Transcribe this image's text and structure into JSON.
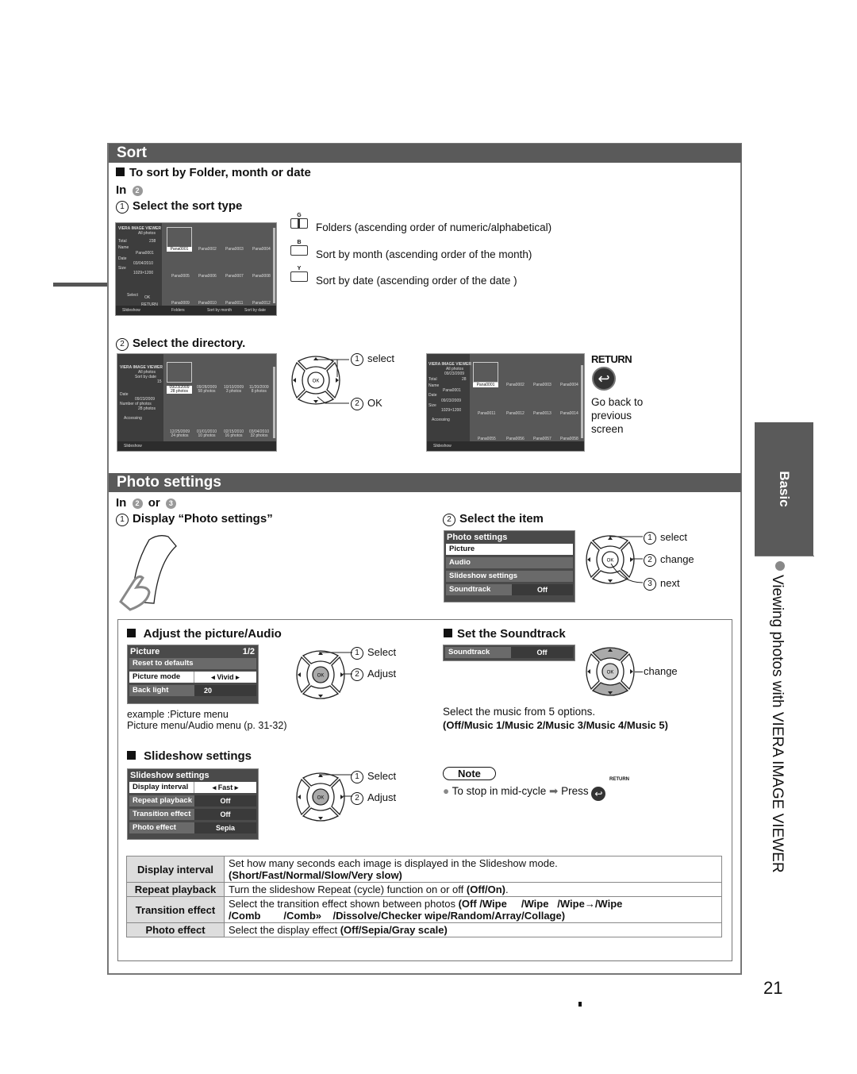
{
  "page_number": "21",
  "side_tab": {
    "label": "Basic"
  },
  "side_title": "Viewing photos with VIERA IMAGE VIEWER",
  "sort": {
    "header": "Sort",
    "subheading": "To sort by Folder, month or date",
    "in_step": "In",
    "in_step_num": "2",
    "step1": {
      "num": "1",
      "label": "Select the sort type"
    },
    "screen1": {
      "title": "VIERA IMAGE VIEWER",
      "subtitle": "All photos",
      "total_label": "Total",
      "total_value": "238",
      "name_label": "Name",
      "name_value": "Pana0001",
      "date_label": "Date",
      "date_value": "03/04/2010",
      "size_label": "Size",
      "size_value": "1029×1200",
      "thumbs": [
        "Pana0001",
        "Pana0002",
        "Pana0003",
        "Pana0004",
        "Pana0005",
        "Pana0006",
        "Pana0007",
        "Pana0008",
        "Pana0009",
        "Pana0010",
        "Pana0011",
        "Pana0012"
      ],
      "footer": [
        "Slideshow",
        "Folders",
        "Sort by month",
        "Sort by date"
      ],
      "select": "Select",
      "ok": "OK",
      "return": "RETURN"
    },
    "sort_options": [
      {
        "key": "G",
        "text": "Folders (ascending order of numeric/alphabetical)"
      },
      {
        "key": "B",
        "text": "Sort by month (ascending order of the month)"
      },
      {
        "key": "Y",
        "text": "Sort by date (ascending order of the date )"
      }
    ],
    "step2": {
      "num": "2",
      "label": "Select the directory."
    },
    "screen2": {
      "title": "VIERA IMAGE VIEWER",
      "subtitle": "All photos",
      "sort_label": "Sort by date",
      "count": "15",
      "date_label": "Date",
      "date_value": "09/23/2009",
      "num_label": "Number of photos",
      "num_value": "28 photos",
      "accessing": "Accessing",
      "thumbs": [
        {
          "date": "09/23/2009",
          "count": "28 photos"
        },
        {
          "date": "09/28/2009",
          "count": "58 photos"
        },
        {
          "date": "10/10/2009",
          "count": "3 photos"
        },
        {
          "date": "11/20/2009",
          "count": "8 photos"
        },
        {
          "date": "12/25/2009",
          "count": "24 photos"
        },
        {
          "date": "01/01/2010",
          "count": "10 photos"
        },
        {
          "date": "02/15/2010",
          "count": "16 photos"
        },
        {
          "date": "03/04/2010",
          "count": "32 photos"
        }
      ],
      "footer": [
        "Slideshow"
      ]
    },
    "dpad1": {
      "select": "select",
      "ok": "OK",
      "n1": "1",
      "n2": "2"
    },
    "screen3": {
      "title": "VIERA IMAGE VIEWER",
      "subtitle": "All photos",
      "date_hdr": "09/23/2009",
      "total_label": "Total",
      "total_value": "28",
      "name_label": "Name",
      "name_value": "Pana0001",
      "date_label": "Date",
      "date_value": "09/23/2009",
      "size_label": "Size",
      "size_value": "1029×1200",
      "accessing": "Accessing",
      "thumbs": [
        "Pana0001",
        "Pana0002",
        "Pana0003",
        "Pana0004",
        "Pana0011",
        "Pana0012",
        "Pana0013",
        "Pana0014",
        "Pana0055",
        "Pana0056",
        "Pana0057",
        "Pana0058"
      ],
      "footer": [
        "Slideshow"
      ]
    },
    "return_label": "RETURN",
    "return_desc": [
      "Go back to",
      "previous",
      "screen"
    ]
  },
  "photo_settings": {
    "header": "Photo settings",
    "in_step": "In",
    "in_num_a": "2",
    "or": "or",
    "in_num_b": "3",
    "step1": {
      "num": "1",
      "label": "Display “Photo settings”"
    },
    "step2": {
      "num": "2",
      "label": "Select the item"
    },
    "menu": {
      "title": "Photo settings",
      "items": [
        "Picture",
        "Audio",
        "Slideshow settings"
      ],
      "soundtrack_label": "Soundtrack",
      "soundtrack_value": "Off"
    },
    "dpad2": {
      "select": "select",
      "change": "change",
      "next": "next",
      "n1": "1",
      "n2": "2",
      "n3": "3"
    },
    "adjust": {
      "heading": "Adjust the picture/Audio",
      "menu_title": "Picture",
      "menu_page": "1/2",
      "rows": [
        {
          "label": "Reset to defaults",
          "value": ""
        },
        {
          "label": "Picture mode",
          "value": "Vivid"
        },
        {
          "label": "Back light",
          "value": "20"
        }
      ],
      "select": "Select",
      "adjust": "Adjust",
      "n1": "1",
      "n2": "2",
      "example": "example :Picture menu",
      "ref": "Picture menu/Audio menu (p. 31-32)"
    },
    "soundtrack": {
      "heading": "Set the Soundtrack",
      "label": "Soundtrack",
      "value": "Off",
      "change": "change",
      "desc": "Select the music from 5 options.",
      "options": "(Off/Music 1/Music 2/Music 3/Music 4/Music 5)"
    },
    "slideshow": {
      "heading": "Slideshow settings",
      "menu_title": "Slideshow settings",
      "rows": [
        {
          "label": "Display interval",
          "value": "Fast"
        },
        {
          "label": "Repeat playback",
          "value": "Off"
        },
        {
          "label": "Transition effect",
          "value": "Off"
        },
        {
          "label": "Photo effect",
          "value": "Sepia"
        }
      ],
      "select": "Select",
      "adjust": "Adjust",
      "n1": "1",
      "n2": "2"
    },
    "note": {
      "label": "Note",
      "text": "To stop in mid-cycle",
      "press": "Press",
      "return_label": "RETURN"
    },
    "table": [
      {
        "key": "Display interval",
        "line1": "Set how many seconds each image is displayed in the Slideshow mode.",
        "line2": "(Short/Fast/Normal/Slow/Very slow)"
      },
      {
        "key": "Repeat playback",
        "line1": "Turn the slideshow Repeat (cycle) function on or off ",
        "line1_bold": "(Off/On)",
        "line1_tail": "."
      },
      {
        "key": "Transition effect",
        "line1": "Select the transition effect shown between photos ",
        "line1_bold": "(Off /Wipe     /Wipe   /Wipe→/Wipe",
        "line2": "/Comb        /Comb»    /Dissolve/Checker wipe/Random/Array/Collage)"
      },
      {
        "key": "Photo effect",
        "line1": "Select the display effect ",
        "line1_bold": "(Off/Sepia/Gray scale)"
      }
    ]
  }
}
